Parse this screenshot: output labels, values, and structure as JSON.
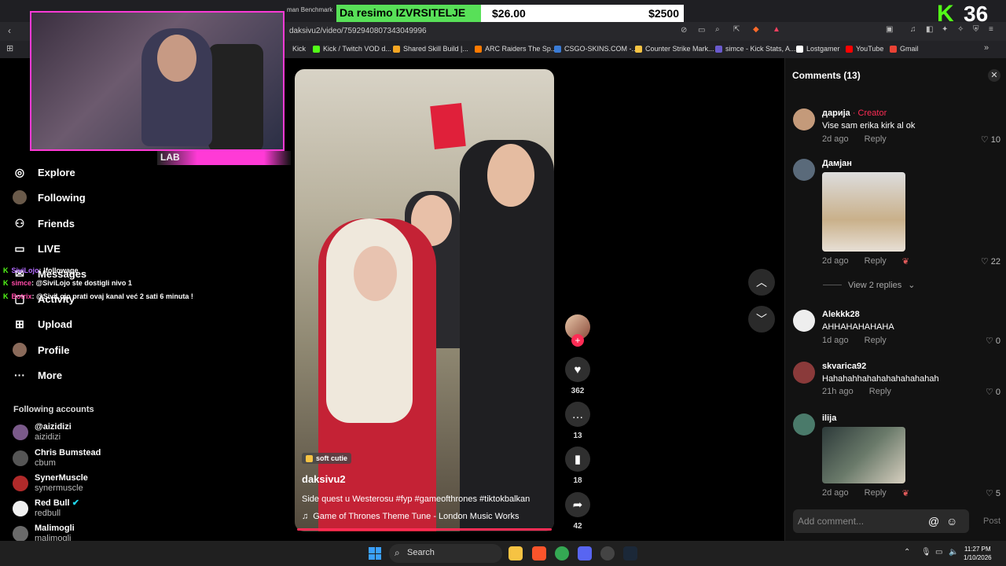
{
  "browser": {
    "url": "daksivu2/video/7592940807343049996",
    "benchmark_fragment": "man Benchmark",
    "bookmarks": [
      {
        "label": "Kick",
        "color": "#53fc18"
      },
      {
        "label": "Kick / Twitch VOD d...",
        "color": "#53fc18"
      },
      {
        "label": "Shared Skill Build |...",
        "color": "#f5a623"
      },
      {
        "label": "ARC Raiders The Sp...",
        "color": "#ff7a00"
      },
      {
        "label": "CSGO-SKINS.COM -...",
        "color": "#3a7bd5"
      },
      {
        "label": "Counter Strike Mark...",
        "color": "#f6c343"
      },
      {
        "label": "simce - Kick Stats, A...",
        "color": "#6a5acd"
      },
      {
        "label": "Lostgamer",
        "color": "#ffffff"
      },
      {
        "label": "YouTube",
        "color": "#ff0000"
      },
      {
        "label": "Gmail",
        "color": "#ea4335"
      }
    ]
  },
  "overlay": {
    "banner_title": "Da resimo IZVRSITELJE",
    "banner_price1": "$26.00",
    "banner_price2": "$2500",
    "viewer_count": "36",
    "cam_label": "LAB"
  },
  "sidebar": {
    "items": [
      {
        "label": "Explore",
        "icon": "compass-icon"
      },
      {
        "label": "Following",
        "icon": "following-icon"
      },
      {
        "label": "Friends",
        "icon": "friends-icon"
      },
      {
        "label": "LIVE",
        "icon": "live-icon"
      },
      {
        "label": "Messages",
        "icon": "messages-icon"
      },
      {
        "label": "Activity",
        "icon": "activity-icon"
      },
      {
        "label": "Upload",
        "icon": "upload-icon"
      },
      {
        "label": "Profile",
        "icon": "profile-icon"
      },
      {
        "label": "More",
        "icon": "more-icon"
      }
    ],
    "following_header": "Following accounts",
    "accounts": [
      {
        "name": "@aizidizi",
        "handle": "aizidizi",
        "color": "#7a5a8a"
      },
      {
        "name": "Chris Bumstead",
        "handle": "cbum",
        "color": "#555555"
      },
      {
        "name": "SynerMuscle",
        "handle": "synermuscle",
        "color": "#b02a2a"
      },
      {
        "name": "Red Bull",
        "handle": "redbull",
        "color": "#f0f0f0"
      },
      {
        "name": "Malimogli",
        "handle": "malimogli",
        "color": "#6a6a6a"
      }
    ]
  },
  "chat": [
    {
      "user": "SiviLojo",
      "message": ": !followage"
    },
    {
      "user": "simce",
      "message": ": @SiviLojo ste dostigli nivo 1"
    },
    {
      "user": "Botrix",
      "message": ": @SiviLojo prati ovaj kanal već 2 sati 6 minuta !"
    }
  ],
  "video": {
    "tag": "soft cutie",
    "author": "daksivu2",
    "caption": "Side quest u Westerosu #fyp #gameofthrones #tiktokbalkan",
    "music": "Game of Thrones Theme Tune - London Music Works",
    "likes": "362",
    "comments": "13",
    "saves": "18",
    "shares": "42"
  },
  "comments_panel": {
    "title": "Comments",
    "count": "(13)",
    "view_replies": "View 2 replies",
    "input_placeholder": "Add comment...",
    "post_label": "Post",
    "reply_label": "Reply",
    "creator_label": "· Creator",
    "comments": [
      {
        "user": "дарија",
        "creator": true,
        "text": "Vise sam erika kirk al ok",
        "time": "2d ago",
        "likes": "10",
        "avatar": "#c49a7a"
      },
      {
        "user": "Дамјан",
        "creator": false,
        "text": "",
        "time": "2d ago",
        "likes": "22",
        "avatar": "#5a6a7a",
        "gif": true
      },
      {
        "user": "Alekkk28",
        "creator": false,
        "text": "AHHAHAHAHAHA",
        "time": "1d ago",
        "likes": "0",
        "avatar": "#eeeeee"
      },
      {
        "user": "skvarica92",
        "creator": false,
        "text": "Hahahahhahahahahahahahah",
        "time": "21h ago",
        "likes": "0",
        "avatar": "#8a3a3a"
      },
      {
        "user": "ilija",
        "creator": false,
        "text": "",
        "time": "2d ago",
        "likes": "5",
        "avatar": "#4a7a6a",
        "gif": true
      }
    ]
  },
  "taskbar": {
    "search_label": "Search",
    "time": "11:27 PM",
    "date": "1/10/2026"
  }
}
